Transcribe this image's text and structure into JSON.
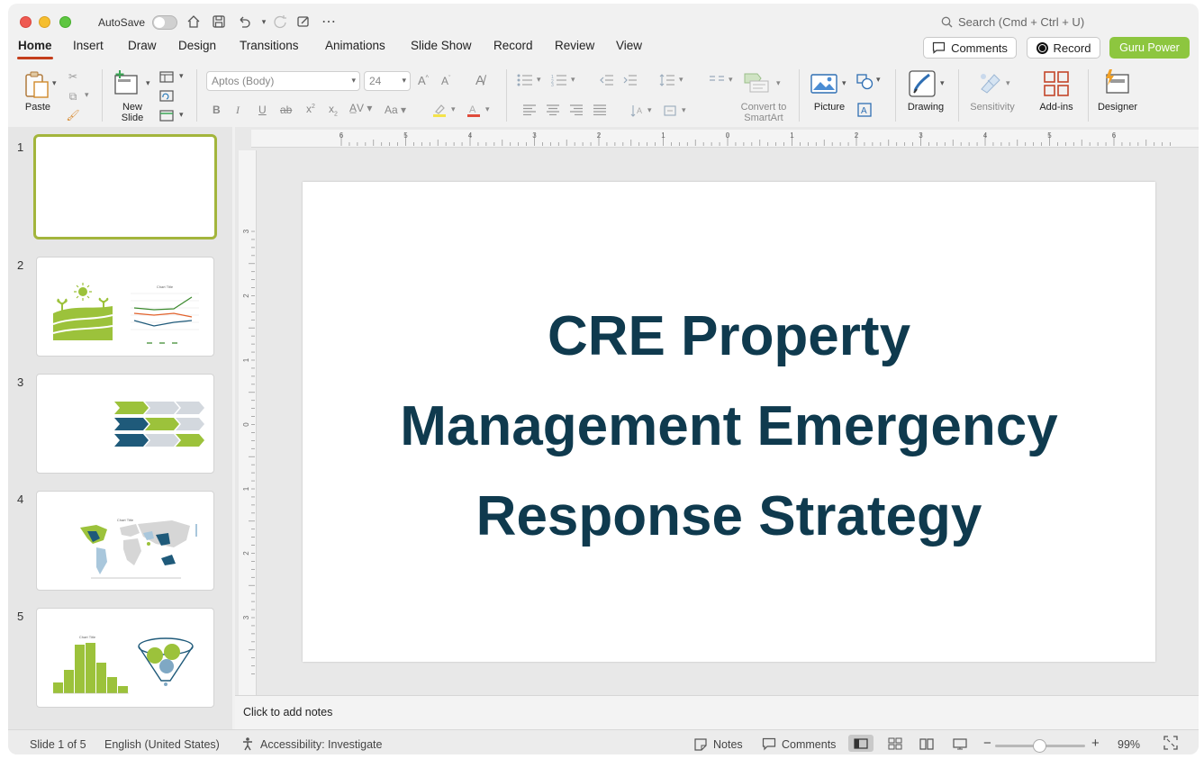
{
  "titlebar": {
    "autosave_label": "AutoSave",
    "search_placeholder": "Search (Cmd + Ctrl + U)"
  },
  "tabs": [
    {
      "label": "Home"
    },
    {
      "label": "Insert"
    },
    {
      "label": "Draw"
    },
    {
      "label": "Design"
    },
    {
      "label": "Transitions"
    },
    {
      "label": "Animations"
    },
    {
      "label": "Slide Show"
    },
    {
      "label": "Record"
    },
    {
      "label": "Review"
    },
    {
      "label": "View"
    }
  ],
  "header_buttons": {
    "comments": "Comments",
    "record": "Record",
    "guru": "Guru Power"
  },
  "ribbon": {
    "paste": "Paste",
    "new_slide_1": "New",
    "new_slide_2": "Slide",
    "font_name": "Aptos (Body)",
    "font_size": "24",
    "convert_1": "Convert to",
    "convert_2": "SmartArt",
    "picture": "Picture",
    "drawing": "Drawing",
    "sensitivity": "Sensitivity",
    "addins": "Add-ins",
    "designer": "Designer"
  },
  "thumbnails": [
    {
      "number": "1"
    },
    {
      "number": "2",
      "chart_title": "Chart Title"
    },
    {
      "number": "3"
    },
    {
      "number": "4",
      "chart_title": "Chart Title"
    },
    {
      "number": "5",
      "chart_title": "Chart Title"
    }
  ],
  "ruler": {
    "h_labels": [
      "6",
      "5",
      "4",
      "3",
      "2",
      "1",
      "0",
      "1",
      "2",
      "3",
      "4",
      "5",
      "6"
    ],
    "v_labels": [
      "3",
      "2",
      "1",
      "0",
      "1",
      "2",
      "3"
    ]
  },
  "slide": {
    "title_line1": "CRE Property",
    "title_line2": "Management Emergency",
    "title_line3": "Response Strategy"
  },
  "notes_placeholder": "Click to add notes",
  "status": {
    "slide_count": "Slide 1 of 5",
    "language": "English (United States)",
    "accessibility": "Accessibility: Investigate",
    "notes": "Notes",
    "comments": "Comments",
    "zoom": "99%"
  },
  "colors": {
    "accent_red": "#c43e1c",
    "guru_green": "#8dc63f",
    "title_navy": "#0f3a4e",
    "thumb_green": "#9cc23b",
    "thumb_navy": "#1f5a7a"
  }
}
